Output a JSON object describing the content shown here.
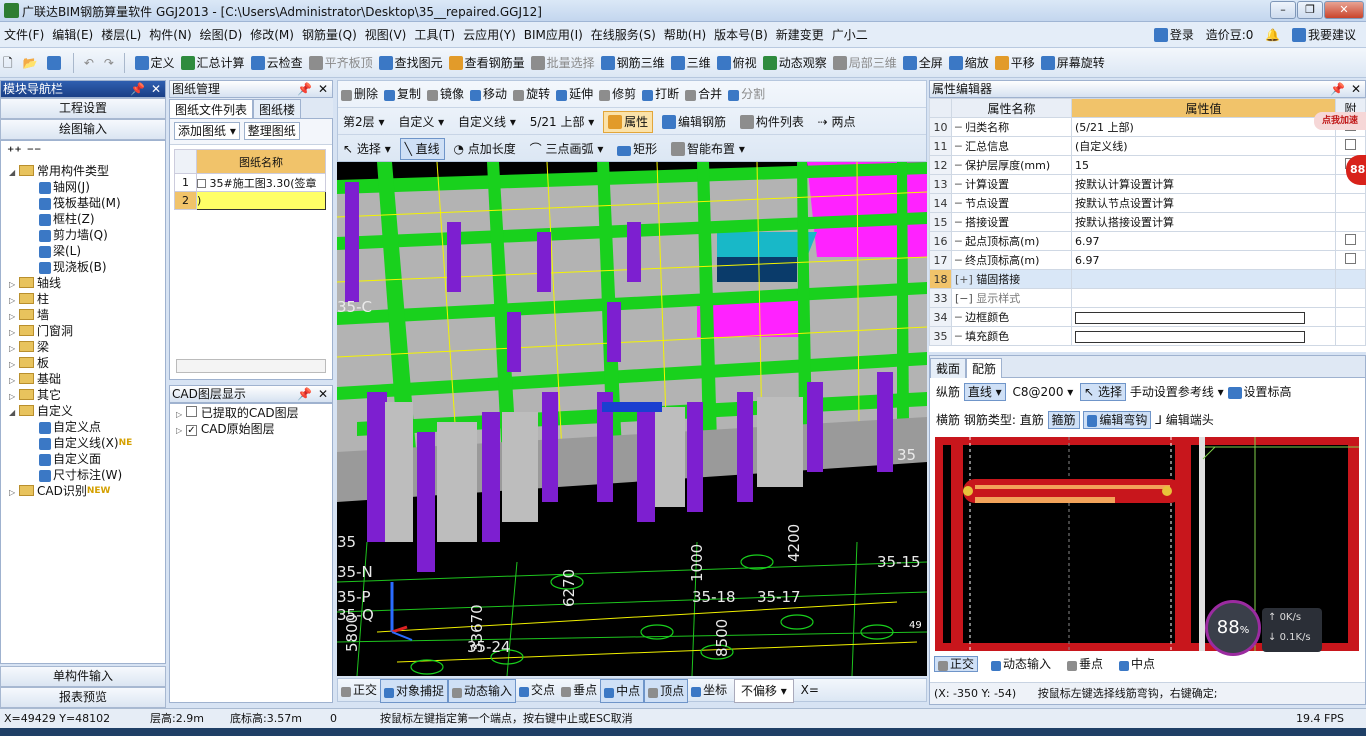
{
  "window": {
    "title": "广联达BIM钢筋算量软件 GGJ2013 - [C:\\Users\\Administrator\\Desktop\\35__repaired.GGJ12]",
    "controls": {
      "minimize": "–",
      "restore": "❐",
      "close": "✕"
    }
  },
  "menu": {
    "items": [
      "文件(F)",
      "编辑(E)",
      "楼层(L)",
      "构件(N)",
      "绘图(D)",
      "修改(M)",
      "钢筋量(Q)",
      "视图(V)",
      "工具(T)",
      "云应用(Y)",
      "BIM应用(I)",
      "在线服务(S)",
      "帮助(H)",
      "版本号(B)",
      "新建变更",
      "广小二"
    ],
    "login": "登录",
    "price": "造价豆:0",
    "suggest": "我要建议"
  },
  "toolbar": {
    "items": [
      "定义",
      "汇总计算",
      "云检查",
      "平齐板顶",
      "查找图元",
      "查看钢筋量",
      "批量选择",
      "钢筋三维",
      "三维",
      "俯视",
      "动态观察",
      "局部三维",
      "全屏",
      "缩放",
      "平移",
      "屏幕旋转"
    ]
  },
  "nav": {
    "title": "模块导航栏",
    "project_settings": "工程设置",
    "draw_input": "绘图输入",
    "tree": [
      {
        "label": "常用构件类型",
        "level": 0,
        "kind": "folder",
        "open": true
      },
      {
        "label": "轴网(J)",
        "level": 1,
        "kind": "item"
      },
      {
        "label": "筏板基础(M)",
        "level": 1,
        "kind": "item"
      },
      {
        "label": "框柱(Z)",
        "level": 1,
        "kind": "item"
      },
      {
        "label": "剪力墙(Q)",
        "level": 1,
        "kind": "item"
      },
      {
        "label": "梁(L)",
        "level": 1,
        "kind": "item"
      },
      {
        "label": "现浇板(B)",
        "level": 1,
        "kind": "item"
      },
      {
        "label": "轴线",
        "level": 0,
        "kind": "folder"
      },
      {
        "label": "柱",
        "level": 0,
        "kind": "folder"
      },
      {
        "label": "墙",
        "level": 0,
        "kind": "folder"
      },
      {
        "label": "门窗洞",
        "level": 0,
        "kind": "folder"
      },
      {
        "label": "梁",
        "level": 0,
        "kind": "folder"
      },
      {
        "label": "板",
        "level": 0,
        "kind": "folder"
      },
      {
        "label": "基础",
        "level": 0,
        "kind": "folder"
      },
      {
        "label": "其它",
        "level": 0,
        "kind": "folder"
      },
      {
        "label": "自定义",
        "level": 0,
        "kind": "folder",
        "open": true
      },
      {
        "label": "自定义点",
        "level": 1,
        "kind": "item"
      },
      {
        "label": "自定义线(X)",
        "level": 1,
        "kind": "item",
        "badge": "NE"
      },
      {
        "label": "自定义面",
        "level": 1,
        "kind": "item"
      },
      {
        "label": "尺寸标注(W)",
        "level": 1,
        "kind": "item"
      },
      {
        "label": "CAD识别",
        "level": 0,
        "kind": "folder",
        "badge": "NEW"
      }
    ],
    "single_input": "单构件输入",
    "report_preview": "报表预览"
  },
  "drawing_manager": {
    "title": "图纸管理",
    "tabs": [
      "图纸文件列表",
      "图纸楼"
    ],
    "add_button": "添加图纸",
    "arrange_button": "整理图纸",
    "column_header": "图纸名称",
    "rows": [
      {
        "num": "1",
        "name": "35#施工图3.30(签章"
      },
      {
        "num": "2",
        "name": ")"
      }
    ]
  },
  "cad_layers": {
    "title": "CAD图层显示",
    "items": [
      {
        "label": "已提取的CAD图层",
        "checked": false
      },
      {
        "label": "CAD原始图层",
        "checked": true
      }
    ]
  },
  "cad_toolbar": {
    "row1": [
      "删除",
      "复制",
      "镜像",
      "移动",
      "旋转",
      "延伸",
      "修剪",
      "打断",
      "合并",
      "分割"
    ],
    "floor": "第2层",
    "type": "自定义",
    "subtype": "自定义线",
    "component": "5/21 上部",
    "property": "属性",
    "edit_rebar": "编辑钢筋",
    "component_list": "构件列表",
    "two_points": "两点",
    "row3": [
      "选择",
      "直线",
      "点加长度",
      "三点画弧",
      "矩形",
      "智能布置"
    ]
  },
  "viewport": {
    "labels": [
      "35-C",
      "35-N",
      "35-P",
      "35-Q",
      "35-18",
      "35-17",
      "35-24",
      "35-15",
      "35",
      "35",
      "6270",
      "1000",
      "4200",
      "8500",
      "33670",
      "5800",
      "49"
    ]
  },
  "view_bottom": {
    "items": [
      "正交",
      "对象捕捉",
      "动态输入",
      "交点",
      "垂点",
      "中点",
      "顶点",
      "坐标"
    ],
    "offset": "不偏移",
    "x_label": "X="
  },
  "property_editor": {
    "title": "属性编辑器",
    "header_name": "属性名称",
    "header_value": "属性值",
    "header_extra": "附",
    "rows": [
      {
        "num": "10",
        "name": "归类名称",
        "value": "(5/21 上部)",
        "check": true
      },
      {
        "num": "11",
        "name": "汇总信息",
        "value": "(自定义线)",
        "check": true
      },
      {
        "num": "12",
        "name": "保护层厚度(mm)",
        "value": "15",
        "check": true
      },
      {
        "num": "13",
        "name": "计算设置",
        "value": "按默认计算设置计算",
        "check": false
      },
      {
        "num": "14",
        "name": "节点设置",
        "value": "按默认节点设置计算",
        "check": false
      },
      {
        "num": "15",
        "name": "搭接设置",
        "value": "按默认搭接设置计算",
        "check": false
      },
      {
        "num": "16",
        "name": "起点顶标高(m)",
        "value": "6.97",
        "check": true
      },
      {
        "num": "17",
        "name": "终点顶标高(m)",
        "value": "6.97",
        "check": true
      },
      {
        "num": "18",
        "name": "锚固搭接",
        "value": "",
        "check": false,
        "highlight": true,
        "expand": "+"
      },
      {
        "num": "33",
        "name": "显示样式",
        "value": "",
        "check": false,
        "expand": "−",
        "muted": true
      },
      {
        "num": "34",
        "name": "边框颜色",
        "value": "",
        "check": false,
        "swatch": true
      },
      {
        "num": "35",
        "name": "填充颜色",
        "value": "",
        "check": false,
        "swatch": true
      }
    ],
    "badge_text": "点我加速",
    "badge_number": "88"
  },
  "rebar_panel": {
    "tabs": [
      "截面",
      "配筋"
    ],
    "longitudinal": "纵筋",
    "line": "直线",
    "spec": "C8@200",
    "select": "选择",
    "manual_ref": "手动设置参考线",
    "set_height": "设置标高",
    "transverse": "横筋",
    "rebar_type_label": "钢筋类型: 直筋",
    "stirrup": "箍筋",
    "edit_bend": "编辑弯钩",
    "edit_end": "编辑端头",
    "bottom": [
      "正交",
      "动态输入",
      "垂点",
      "中点"
    ],
    "gauge": "88",
    "gauge_unit": "%",
    "up_speed": "0K/s",
    "down_speed": "0.1K/s",
    "coords": "(X: -350 Y: -54)",
    "hint": "按鼠标左键选择线筋弯钩，右键确定;"
  },
  "status": {
    "coords": "X=49429 Y=48102",
    "floor_height": "层高:2.9m",
    "bottom_height": "底标高:3.57m",
    "zero": "0",
    "hint": "按鼠标左键指定第一个端点，按右键中止或ESC取消",
    "fps": "19.4 FPS"
  },
  "colors": {
    "beam_green": "#19d11d",
    "column_purple": "#7d1fd0",
    "slab_gray": "#b3b3b3",
    "magenta": "#ff22ff",
    "cyan": "#18b8c8",
    "rebar_red": "#c8161c",
    "highlight_yellow": "#ffff66"
  }
}
